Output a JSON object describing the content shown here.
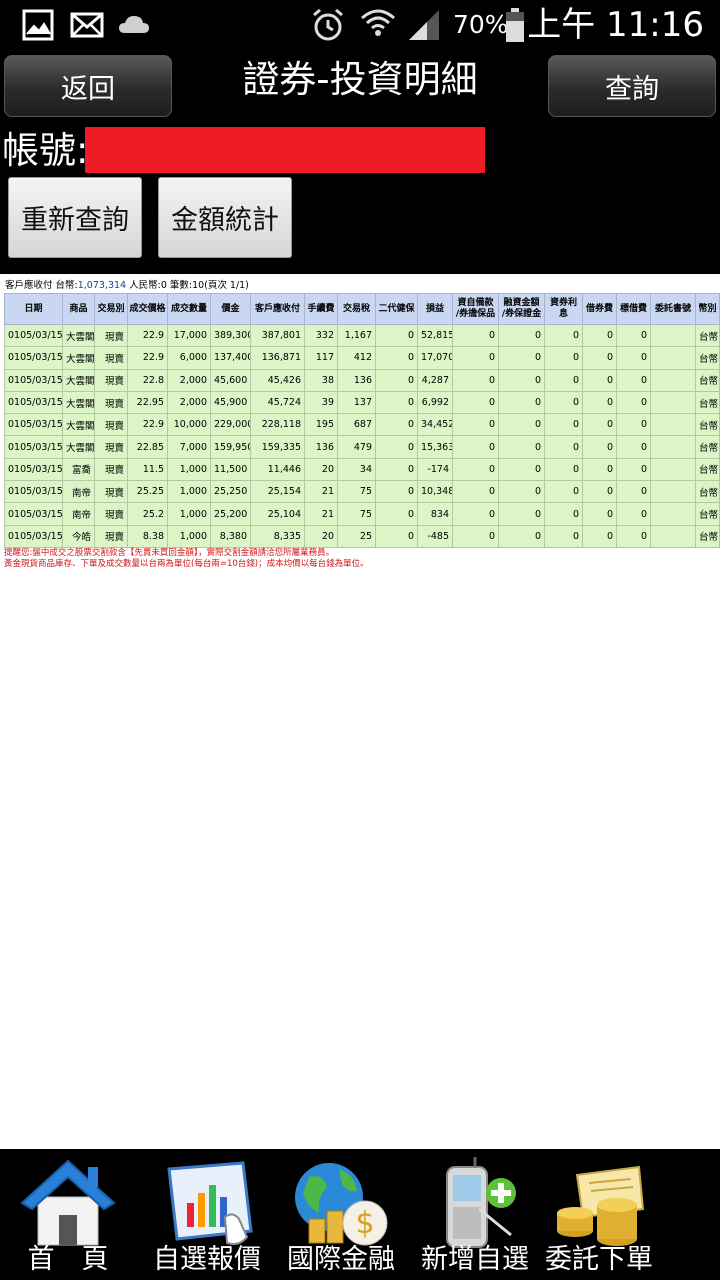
{
  "status_bar": {
    "battery_percent": "70%",
    "time": "上午 11:16"
  },
  "header": {
    "back_label": "返回",
    "title": "證券-投資明細",
    "query_label": "查詢",
    "account_label": "帳號:",
    "requery_label": "重新查詢",
    "amount_stats_label": "金額統計"
  },
  "summary": {
    "prefix": "客戶應收付 台幣:",
    "twd_amount": "1,073,314",
    "suffix": " 人民幣:0 筆數:10(頁次 1/1)"
  },
  "table": {
    "columns": [
      "日期",
      "商品",
      "交易別",
      "成交價格",
      "成交數量",
      "價金",
      "客戶應收付",
      "手續費",
      "交易稅",
      "二代健保",
      "損益",
      "資自備款\n/券擔保品",
      "融資金額\n/券保證金",
      "資券利息",
      "借券費",
      "標借費",
      "委託書號",
      "幣別"
    ],
    "rows": [
      [
        "0105/03/15",
        "大雲閣",
        "現賣",
        "22.9",
        "17,000",
        "389,300",
        "387,801",
        "332",
        "1,167",
        "0",
        "52,815",
        "0",
        "0",
        "0",
        "0",
        "0",
        "",
        "台幣"
      ],
      [
        "0105/03/15",
        "大雲閣",
        "現賣",
        "22.9",
        "6,000",
        "137,400",
        "136,871",
        "117",
        "412",
        "0",
        "17,070",
        "0",
        "0",
        "0",
        "0",
        "0",
        "",
        "台幣"
      ],
      [
        "0105/03/15",
        "大雲閣",
        "現賣",
        "22.8",
        "2,000",
        "45,600",
        "45,426",
        "38",
        "136",
        "0",
        "4,287",
        "0",
        "0",
        "0",
        "0",
        "0",
        "",
        "台幣"
      ],
      [
        "0105/03/15",
        "大雲閣",
        "現賣",
        "22.95",
        "2,000",
        "45,900",
        "45,724",
        "39",
        "137",
        "0",
        "6,992",
        "0",
        "0",
        "0",
        "0",
        "0",
        "",
        "台幣"
      ],
      [
        "0105/03/15",
        "大雲閣",
        "現賣",
        "22.9",
        "10,000",
        "229,000",
        "228,118",
        "195",
        "687",
        "0",
        "34,452",
        "0",
        "0",
        "0",
        "0",
        "0",
        "",
        "台幣"
      ],
      [
        "0105/03/15",
        "大雲閣",
        "現賣",
        "22.85",
        "7,000",
        "159,950",
        "159,335",
        "136",
        "479",
        "0",
        "15,363",
        "0",
        "0",
        "0",
        "0",
        "0",
        "",
        "台幣"
      ],
      [
        "0105/03/15",
        "富喬",
        "現賣",
        "11.5",
        "1,000",
        "11,500",
        "11,446",
        "20",
        "34",
        "0",
        "-174",
        "0",
        "0",
        "0",
        "0",
        "0",
        "",
        "台幣"
      ],
      [
        "0105/03/15",
        "南帝",
        "現賣",
        "25.25",
        "1,000",
        "25,250",
        "25,154",
        "21",
        "75",
        "0",
        "10,348",
        "0",
        "0",
        "0",
        "0",
        "0",
        "",
        "台幣"
      ],
      [
        "0105/03/15",
        "南帝",
        "現賣",
        "25.2",
        "1,000",
        "25,200",
        "25,104",
        "21",
        "75",
        "0",
        "834",
        "0",
        "0",
        "0",
        "0",
        "0",
        "",
        "台幣"
      ],
      [
        "0105/03/15",
        "今皓",
        "現賣",
        "8.38",
        "1,000",
        "8,380",
        "8,335",
        "20",
        "25",
        "0",
        "-485",
        "0",
        "0",
        "0",
        "0",
        "0",
        "",
        "台幣"
      ]
    ]
  },
  "notes": [
    "提醒您:盤中成交之股票交割款含【先賣未買回金額】，實際交割金額請洽您所屬業務員。",
    "黃金現貨商品庫存、下單及成交數量以台兩為單位(每台兩=10台錢)；成本均價以每台錢為單位。"
  ],
  "bottom_nav": [
    {
      "label": "首　頁",
      "icon": "home-icon"
    },
    {
      "label": "自選報價",
      "icon": "watchlist-quote-icon"
    },
    {
      "label": "國際金融",
      "icon": "globe-finance-icon"
    },
    {
      "label": "新增自選",
      "icon": "add-watchlist-phone-icon"
    },
    {
      "label": "委託下單",
      "icon": "gold-coins-order-icon"
    }
  ]
}
